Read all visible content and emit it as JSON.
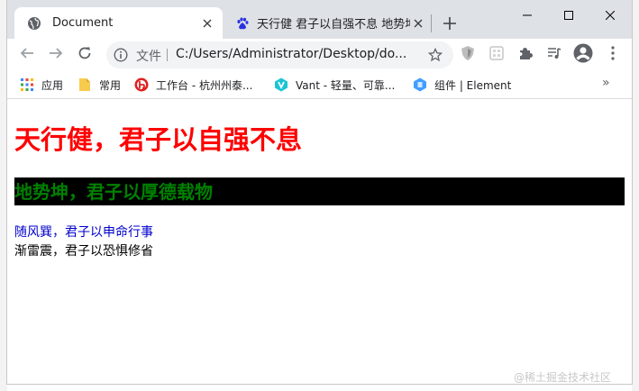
{
  "tabs": [
    {
      "title": "Document",
      "active": true,
      "favicon": "globe-icon"
    },
    {
      "title": "天行健 君子以自强不息 地势坤",
      "active": false,
      "favicon": "baidu-paw-icon"
    }
  ],
  "window_controls": {
    "minimize": "minimize-icon",
    "maximize": "maximize-icon",
    "close": "close-icon"
  },
  "toolbar": {
    "back": "back-arrow-icon",
    "forward": "forward-arrow-icon",
    "reload": "reload-icon"
  },
  "address_bar": {
    "label": "文件",
    "url": "C:/Users/Administrator/Desktop/do..."
  },
  "bookmarks": [
    {
      "label": "应用",
      "icon": "apps-grid-icon"
    },
    {
      "label": "常用",
      "icon": "folder-icon"
    },
    {
      "label": "工作台 - 杭州州泰...",
      "icon": "workbench-logo-icon"
    },
    {
      "label": "Vant - 轻量、可靠...",
      "icon": "vant-logo-icon"
    },
    {
      "label": "组件 | Element",
      "icon": "element-logo-icon"
    }
  ],
  "bookmarks_more": "»",
  "page": {
    "heading1": "天行健，君子以自强不息",
    "heading2": "地势坤，君子以厚德载物",
    "paragraph1": "随风巽，君子以申命行事",
    "paragraph2": "渐雷震，君子以恐惧修省"
  },
  "watermark": "@稀土掘金技术社区",
  "colors": {
    "heading1": "#ff0000",
    "heading2_text": "#008000",
    "heading2_bg": "#000000",
    "paragraph1": "#0000cc",
    "paragraph2": "#000000"
  }
}
